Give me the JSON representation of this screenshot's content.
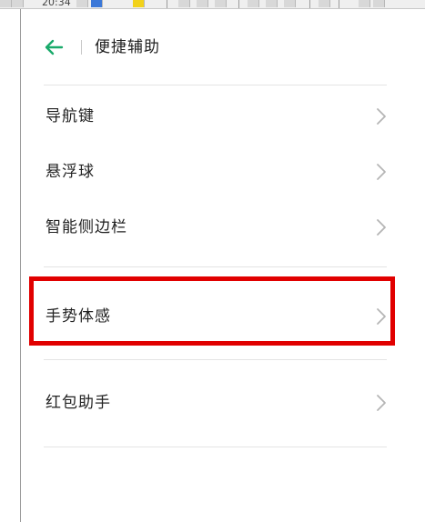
{
  "header": {
    "title": "便捷辅助",
    "back_icon": "arrow-left-icon",
    "back_icon_color": "#1aaa6b"
  },
  "status_bar": {
    "time": "20:34"
  },
  "menu": {
    "items": [
      {
        "label": "导航键",
        "icon": "chevron-right-icon"
      },
      {
        "label": "悬浮球",
        "icon": "chevron-right-icon"
      },
      {
        "label": "智能侧边栏",
        "icon": "chevron-right-icon"
      },
      {
        "label": "手势体感",
        "icon": "chevron-right-icon",
        "highlighted": true
      },
      {
        "label": "红包助手",
        "icon": "chevron-right-icon"
      }
    ]
  },
  "colors": {
    "highlight": "#e10000",
    "text": "#222222",
    "chevron": "#b5b5b5",
    "divider": "#e4e4e4"
  }
}
